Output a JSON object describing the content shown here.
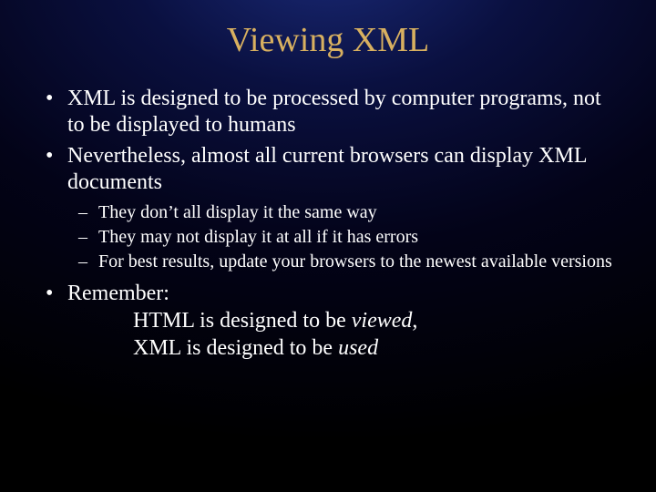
{
  "title": "Viewing XML",
  "bullets": {
    "b1": "XML is designed to be processed by computer programs, not to be displayed to humans",
    "b2": "Nevertheless, almost all current browsers can display XML documents",
    "sub": {
      "s1": "They don’t all display it the same way",
      "s2": "They may not display it at all if it has errors",
      "s3": "For best results, update your browsers to the newest available versions"
    },
    "b3": {
      "lead": "Remember:",
      "line1a": "HTML is designed to be ",
      "line1b": "viewed",
      "line1c": ",",
      "line2a": "XML is designed to be ",
      "line2b": "used"
    }
  }
}
